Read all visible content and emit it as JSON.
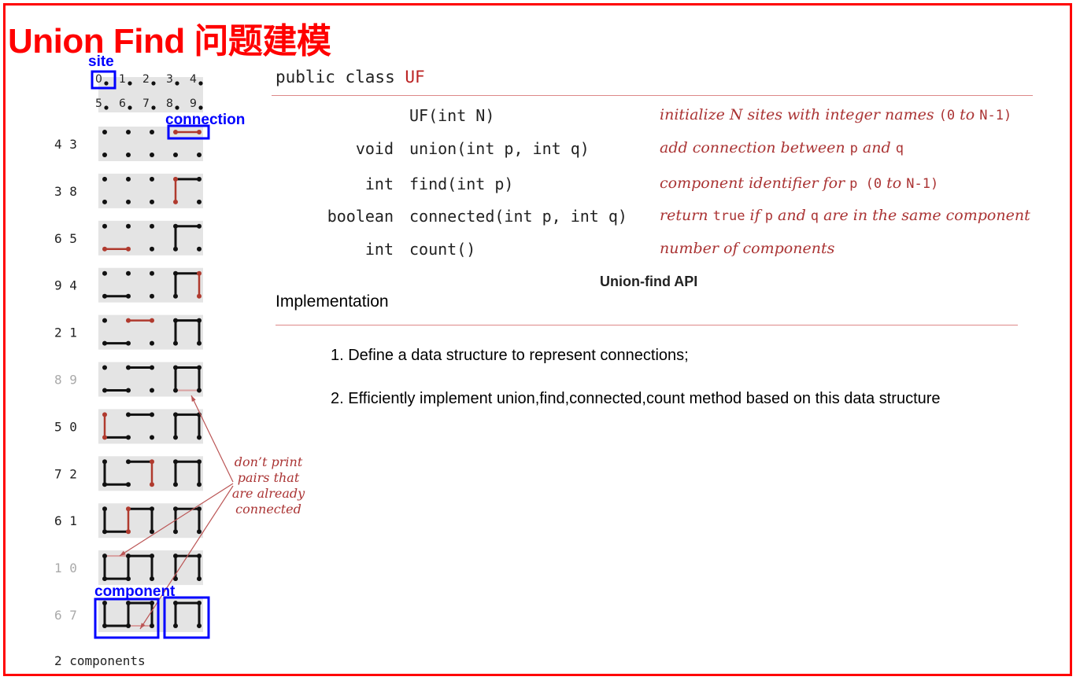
{
  "title": "Union Find 问题建模",
  "api": {
    "class_keyword": "public class",
    "class_name": "UF",
    "rows": [
      {
        "ret": "",
        "sig": "UF(int N)",
        "desc": [
          {
            "t": "initialize N sites with integer names ",
            "m": false
          },
          {
            "t": "(0",
            "m": true
          },
          {
            "t": " to ",
            "m": false
          },
          {
            "t": "N-1)",
            "m": true
          }
        ]
      },
      {
        "ret": "void",
        "sig": "union(int p, int q)",
        "desc": [
          {
            "t": "add connection between ",
            "m": false
          },
          {
            "t": "p",
            "m": true
          },
          {
            "t": " and ",
            "m": false
          },
          {
            "t": "q",
            "m": true
          }
        ]
      },
      {
        "ret": "int",
        "sig": "find(int p)",
        "desc": [
          {
            "t": "component identifier for ",
            "m": false
          },
          {
            "t": "p (0",
            "m": true
          },
          {
            "t": " to ",
            "m": false
          },
          {
            "t": "N-1)",
            "m": true
          }
        ]
      },
      {
        "ret": "boolean",
        "sig": "connected(int p, int q)",
        "desc": [
          {
            "t": "return ",
            "m": false
          },
          {
            "t": "true",
            "m": true
          },
          {
            "t": " if ",
            "m": false
          },
          {
            "t": "p",
            "m": true
          },
          {
            "t": " and ",
            "m": false
          },
          {
            "t": "q",
            "m": true
          },
          {
            "t": " are in the same component",
            "m": false
          }
        ]
      },
      {
        "ret": "int",
        "sig": "count()",
        "desc": [
          {
            "t": "number of components",
            "m": false
          }
        ]
      }
    ],
    "caption": "Union-find API"
  },
  "implementation": {
    "heading": "Implementation",
    "items": [
      "1. Define a data structure to represent connections;",
      "2. Efficiently implement union,find,connected,count method based on this data structure"
    ]
  },
  "diagram": {
    "site_labels": [
      "0",
      "1",
      "2",
      "3",
      "4",
      "5",
      "6",
      "7",
      "8",
      "9"
    ],
    "pairs": [
      {
        "label": "4 3",
        "p": 4,
        "q": 3,
        "redundant": false
      },
      {
        "label": "3 8",
        "p": 3,
        "q": 8,
        "redundant": false
      },
      {
        "label": "6 5",
        "p": 6,
        "q": 5,
        "redundant": false
      },
      {
        "label": "9 4",
        "p": 9,
        "q": 4,
        "redundant": false
      },
      {
        "label": "2 1",
        "p": 2,
        "q": 1,
        "redundant": false
      },
      {
        "label": "8 9",
        "p": 8,
        "q": 9,
        "redundant": true
      },
      {
        "label": "5 0",
        "p": 5,
        "q": 0,
        "redundant": false
      },
      {
        "label": "7 2",
        "p": 7,
        "q": 2,
        "redundant": false
      },
      {
        "label": "6 1",
        "p": 6,
        "q": 1,
        "redundant": false
      },
      {
        "label": "1 0",
        "p": 1,
        "q": 0,
        "redundant": true
      },
      {
        "label": "6 7",
        "p": 6,
        "q": 7,
        "redundant": true
      }
    ],
    "note_lines": [
      "don’t print",
      "pairs that",
      "are already",
      "connected"
    ],
    "result": "2 components",
    "annotations": {
      "site": "site",
      "connection": "connection",
      "component": "component"
    },
    "colors": {
      "new_edge": "#b03a2e",
      "edge": "#111111",
      "panel": "#e4e4e4",
      "annotation": "#0000ff",
      "frame": "#ff0000"
    }
  }
}
